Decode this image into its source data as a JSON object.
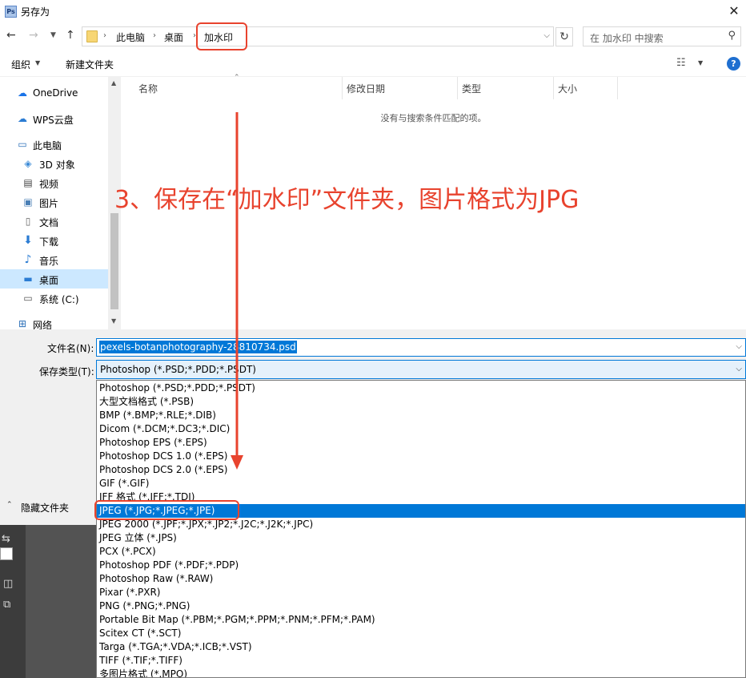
{
  "window": {
    "title": "另存为",
    "app_icon_text": "Ps"
  },
  "address": {
    "crumbs": [
      "此电脑",
      "桌面",
      "加水印"
    ],
    "search_placeholder": "在 加水印 中搜索"
  },
  "toolbar": {
    "organize": "组织",
    "new_folder": "新建文件夹"
  },
  "sidebar": {
    "items": [
      {
        "label": "OneDrive",
        "icon": "cloud-icon"
      },
      {
        "label": "WPS云盘",
        "icon": "cloud-icon"
      },
      {
        "label": "此电脑",
        "icon": "computer-icon"
      },
      {
        "label": "3D 对象",
        "icon": "cube-icon"
      },
      {
        "label": "视频",
        "icon": "video-icon"
      },
      {
        "label": "图片",
        "icon": "picture-icon"
      },
      {
        "label": "文档",
        "icon": "document-icon"
      },
      {
        "label": "下载",
        "icon": "download-icon"
      },
      {
        "label": "音乐",
        "icon": "music-icon"
      },
      {
        "label": "桌面",
        "icon": "desktop-icon",
        "selected": true
      },
      {
        "label": "系统 (C:)",
        "icon": "drive-icon"
      },
      {
        "label": "网络",
        "icon": "network-icon"
      }
    ]
  },
  "filelist": {
    "columns": [
      "名称",
      "修改日期",
      "类型",
      "大小"
    ],
    "empty_message": "没有与搜索条件匹配的项。"
  },
  "form": {
    "filename_label": "文件名(N):",
    "filename_value": "pexels-botanphotography-28810734.psd",
    "type_label": "保存类型(T):",
    "type_value": "Photoshop (*.PSD;*.PDD;*.PSDT)",
    "hide_folders": "隐藏文件夹"
  },
  "dropdown": {
    "options": [
      "Photoshop (*.PSD;*.PDD;*.PSDT)",
      "大型文档格式 (*.PSB)",
      "BMP (*.BMP;*.RLE;*.DIB)",
      "Dicom (*.DCM;*.DC3;*.DIC)",
      "Photoshop EPS (*.EPS)",
      "Photoshop DCS 1.0 (*.EPS)",
      "Photoshop DCS 2.0 (*.EPS)",
      "GIF (*.GIF)",
      "IFF 格式 (*.IFF;*.TDI)",
      "JPEG (*.JPG;*.JPEG;*.JPE)",
      "JPEG 2000 (*.JPF;*.JPX;*.JP2;*.J2C;*.J2K;*.JPC)",
      "JPEG 立体 (*.JPS)",
      "PCX (*.PCX)",
      "Photoshop PDF (*.PDF;*.PDP)",
      "Photoshop Raw (*.RAW)",
      "Pixar (*.PXR)",
      "PNG (*.PNG;*.PNG)",
      "Portable Bit Map (*.PBM;*.PGM;*.PPM;*.PNM;*.PFM;*.PAM)",
      "Scitex CT (*.SCT)",
      "Targa (*.TGA;*.VDA;*.ICB;*.VST)",
      "TIFF (*.TIF;*.TIFF)",
      "多图片格式 (*.MPO)"
    ],
    "selected_index": 9
  },
  "annotation": {
    "text": "3、保存在“加水印”文件夹，图片格式为JPG"
  },
  "colors": {
    "accent": "#0078d7",
    "annotation": "#e8432e",
    "selection": "#cce8ff"
  }
}
